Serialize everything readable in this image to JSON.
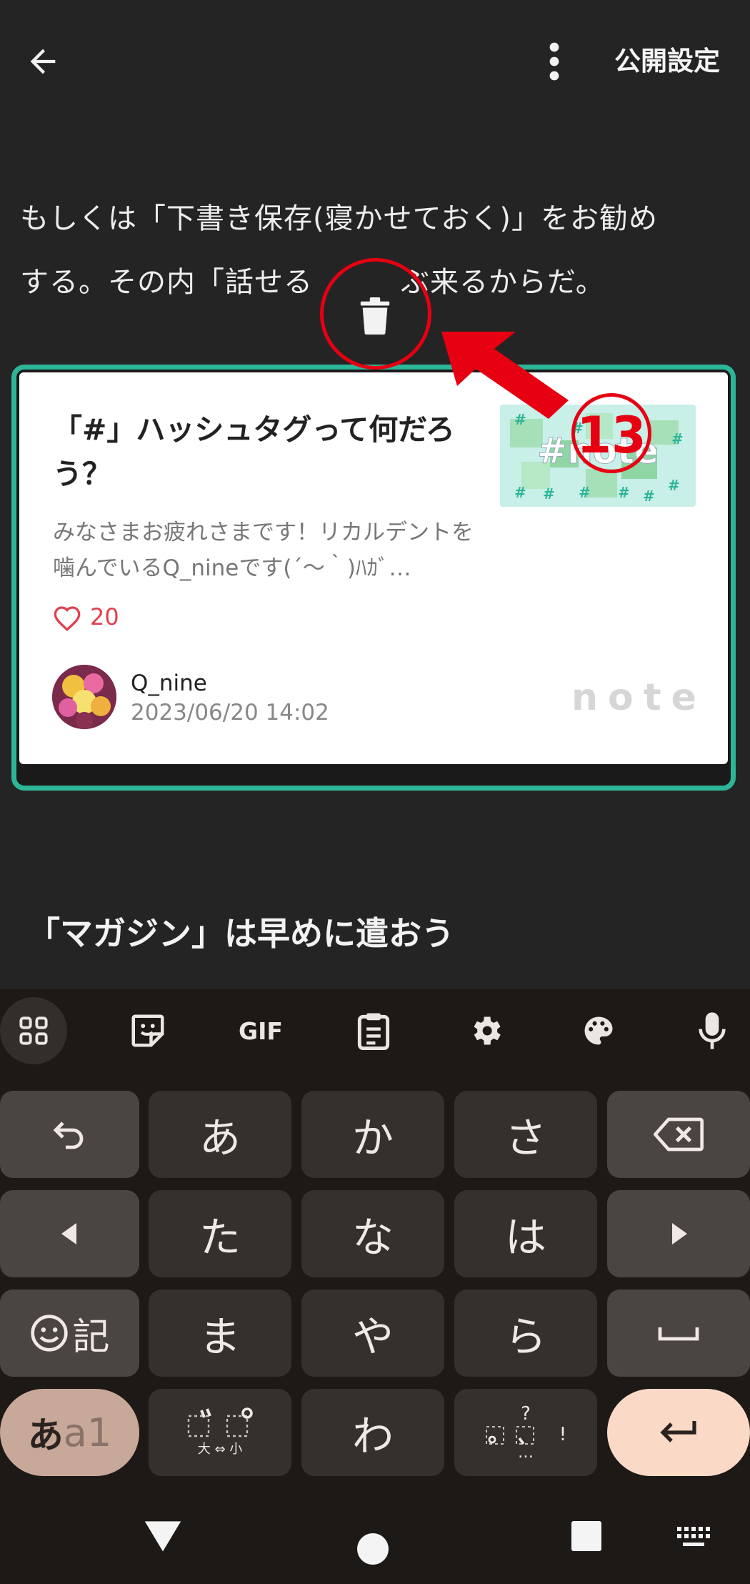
{
  "header": {
    "publish_label": "公開設定"
  },
  "body": {
    "para1": "もしくは「下書き保存(寝かせておく)」をお勧め",
    "para2": "する。その内「話せる　　　ぶ来るからだ。",
    "heading": "「マガジン」は早めに遣おう"
  },
  "annotation": {
    "number": "13",
    "color": "#e60012"
  },
  "card": {
    "title": "「#」ハッシュタグって何だろう？",
    "description": "みなさまお疲れさまです！リカルデントを噛んでいるQ_nineです(´〜｀)ﾊｶﾞ…",
    "likes": "20",
    "author": "Q_nine",
    "date": "2023/06/20 14:02",
    "logo": "note",
    "thumbnail_text": "#note",
    "accent": "#2cb597"
  },
  "keyboard": {
    "toolbar": [
      "apps-icon",
      "sticker-icon",
      "GIF",
      "clipboard-icon",
      "settings-icon",
      "palette-icon",
      "mic-icon"
    ],
    "gif_label": "GIF",
    "rows": {
      "r1": [
        "undo-icon",
        "あ",
        "か",
        "さ",
        "backspace-icon"
      ],
      "r2": [
        "left-arrow-icon",
        "た",
        "な",
        "は",
        "right-arrow-icon"
      ],
      "r3": [
        "記",
        "ま",
        "や",
        "ら",
        "space-icon"
      ],
      "r4": [
        "あa1",
        "゛゜ 大⇔小",
        "わ",
        "、。?!",
        "enter-icon"
      ]
    },
    "k_a": "あ",
    "k_ka": "か",
    "k_sa": "さ",
    "k_ta": "た",
    "k_na": "な",
    "k_ha": "は",
    "k_ki": "記",
    "k_ma": "ま",
    "k_ya": "や",
    "k_ra": "ら",
    "k_wa": "わ",
    "k_toggle_a": "あ",
    "k_toggle_a1": "a1",
    "k_dakuten_small": "大 ⇔ 小",
    "k_punct_q": "?",
    "k_punct_excl": "!",
    "k_punct_dots": "…"
  }
}
